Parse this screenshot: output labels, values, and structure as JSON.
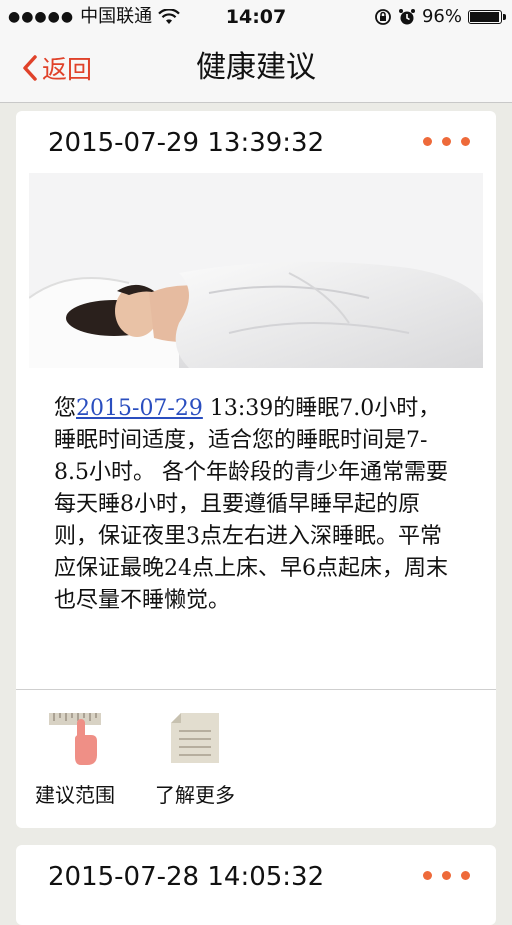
{
  "status_bar": {
    "signal": "●●●●●",
    "carrier": "中国联通",
    "time": "14:07",
    "battery": "96%",
    "battery_level": 0.96
  },
  "nav": {
    "back_label": "返回",
    "title": "健康建议"
  },
  "cards": [
    {
      "timestamp": "2015-07-29 13:39:32",
      "advice_prefix": "您",
      "advice_date": "2015-07-29",
      "advice_body": " 13:39的睡眠7.0小时，睡眠时间适度，适合您的睡眠时间是7-8.5小时。 各个年龄段的青少年通常需要每天睡8小时，且要遵循早睡早起的原则，保证夜里3点左右进入深睡眠。平常应保证最晚24点上床、早6点起床，周末也尽量不睡懒觉。",
      "actions": [
        {
          "label": "建议范围",
          "icon": "ruler-hand-icon"
        },
        {
          "label": "了解更多",
          "icon": "document-icon"
        }
      ]
    },
    {
      "timestamp": "2015-07-28 14:05:32"
    }
  ],
  "colors": {
    "accent": "#e0422a",
    "dots": "#ee6a3a",
    "link": "#2a4ebf"
  }
}
